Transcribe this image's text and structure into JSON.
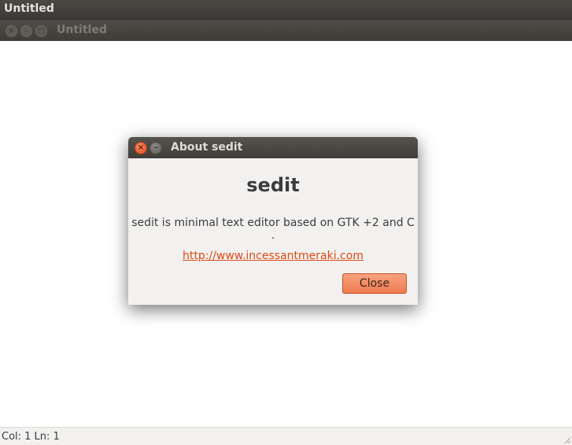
{
  "top_panel": {
    "title": "Untitled"
  },
  "window": {
    "title": "Untitled",
    "controls": {
      "close": "×",
      "minimize": "–",
      "maximize": "□"
    }
  },
  "statusbar": {
    "text": "Col: 1 Ln: 1"
  },
  "about_dialog": {
    "title": "About sedit",
    "close_glyph": "×",
    "minimize_glyph": "–",
    "program_name": "sedit",
    "comments": "sedit is minimal text editor based on GTK +2 and C .",
    "website": "http://www.incessantmeraki.com",
    "close_label": "Close"
  },
  "colors": {
    "panel_bg": "#3b3a36",
    "dialog_bg": "#f2f1f0",
    "accent": "#ef7b4f",
    "link": "#dd4814"
  }
}
